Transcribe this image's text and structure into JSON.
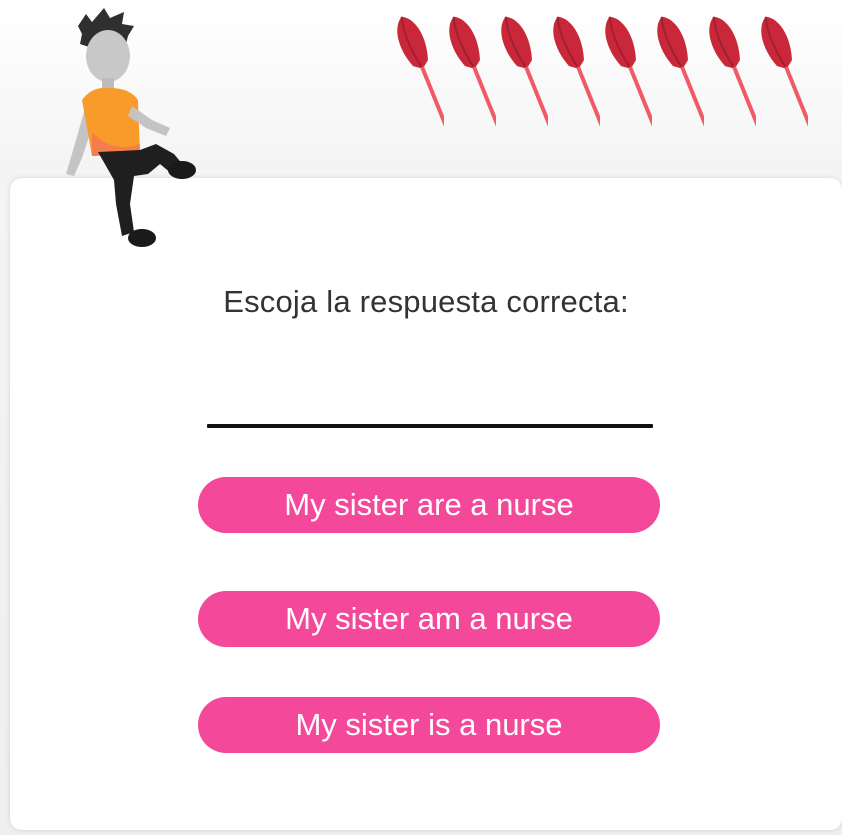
{
  "quiz": {
    "prompt": "Escoja la respuesta correcta:",
    "options": [
      {
        "label": "My sister are a nurse"
      },
      {
        "label": "My sister am a nurse"
      },
      {
        "label": "My sister is a nurse"
      }
    ],
    "lives_remaining": 8
  },
  "colors": {
    "button": "#f4489a",
    "button_text": "#ffffff",
    "prompt_text": "#333333",
    "dart_flight": "#c8283a",
    "dart_shaft": "#f05a66",
    "dart_tip": "#9a9a9a",
    "shirt": "#f99b2a"
  },
  "icons": {
    "character": "boy-sitting-illustration",
    "dart": "dart-icon"
  }
}
